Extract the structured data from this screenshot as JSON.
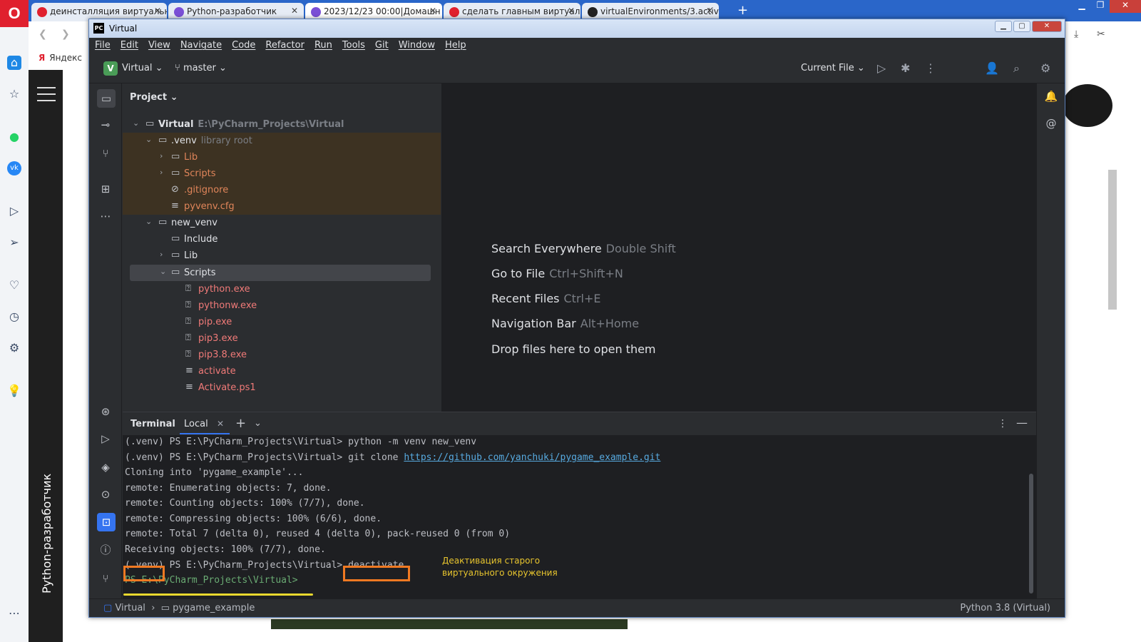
{
  "browser": {
    "logo": "O",
    "tabs": [
      {
        "label": "деинсталляция виртуальн",
        "fav_color": "#e0202e"
      },
      {
        "label": "Python-разработчик",
        "fav_color": "#7a4fd6"
      },
      {
        "label": "2023/12/23 00:00|Домашн",
        "fav_color": "#7a4fd6"
      },
      {
        "label": "сделать главным виртуал",
        "fav_color": "#e0202e"
      },
      {
        "label": "virtualEnvironments/3.activ",
        "fav_color": "#222222"
      }
    ],
    "new_tab": "+",
    "bookmark": "Яндекс",
    "bookmark_icon": "Я",
    "side_panel_title": "Python-разработчик"
  },
  "ide": {
    "window_title": "Virtual",
    "app_icon": "PC",
    "menu": [
      "File",
      "Edit",
      "View",
      "Navigate",
      "Code",
      "Refactor",
      "Run",
      "Tools",
      "Git",
      "Window",
      "Help"
    ],
    "toolbar": {
      "project_badge": "V",
      "project_name": "Virtual",
      "branch": "master",
      "run_config": "Current File"
    },
    "project_panel": {
      "title": "Project",
      "tree": [
        {
          "label": "Virtual",
          "hint": "E:\\PyCharm_Projects\\Virtual"
        },
        {
          "label": ".venv",
          "hint": "library root"
        },
        {
          "label": "Lib"
        },
        {
          "label": "Scripts"
        },
        {
          "label": ".gitignore"
        },
        {
          "label": "pyvenv.cfg"
        },
        {
          "label": "new_venv"
        },
        {
          "label": "Include"
        },
        {
          "label": "Lib"
        },
        {
          "label": "Scripts"
        },
        {
          "label": "python.exe"
        },
        {
          "label": "pythonw.exe"
        },
        {
          "label": "pip.exe"
        },
        {
          "label": "pip3.exe"
        },
        {
          "label": "pip3.8.exe"
        },
        {
          "label": "activate"
        },
        {
          "label": "Activate.ps1"
        }
      ]
    },
    "editor_hints": [
      {
        "action": "Search Everywhere",
        "shortcut": "Double Shift"
      },
      {
        "action": "Go to File",
        "shortcut": "Ctrl+Shift+N"
      },
      {
        "action": "Recent Files",
        "shortcut": "Ctrl+E"
      },
      {
        "action": "Navigation Bar",
        "shortcut": "Alt+Home"
      },
      {
        "action": "Drop files here to open them",
        "shortcut": ""
      }
    ],
    "terminal": {
      "title": "Terminal",
      "tab": "Local",
      "lines": [
        "(.venv) PS E:\\PyCharm_Projects\\Virtual> python -m venv new_venv",
        "(.venv) PS E:\\PyCharm_Projects\\Virtual> git clone ",
        "Cloning into 'pygame_example'...",
        "remote: Enumerating objects: 7, done.",
        "remote: Counting objects: 100% (7/7), done.",
        "remote: Compressing objects: 100% (6/6), done.",
        "remote: Total 7 (delta 0), reused 4 (delta 0), pack-reused 0 (from 0)",
        "Receiving objects: 100% (7/7), done."
      ],
      "clone_url": "https://github.com/yanchuki/pygame_example.git",
      "last_cmd_prefix": "(.venv)",
      "last_cmd_path": " PS E:\\PyCharm_Projects\\Virtual> ",
      "last_cmd": "deactivate",
      "prompt": "PS E:\\PyCharm_Projects\\Virtual>",
      "annotation": "Деактивация старого\nвиртуального окружения",
      "annotation_color": "#e8c52e",
      "highlight_color": "#f07922"
    },
    "status": {
      "breadcrumb_project": "Virtual",
      "breadcrumb_folder": "pygame_example",
      "interpreter": "Python 3.8 (Virtual)"
    }
  }
}
